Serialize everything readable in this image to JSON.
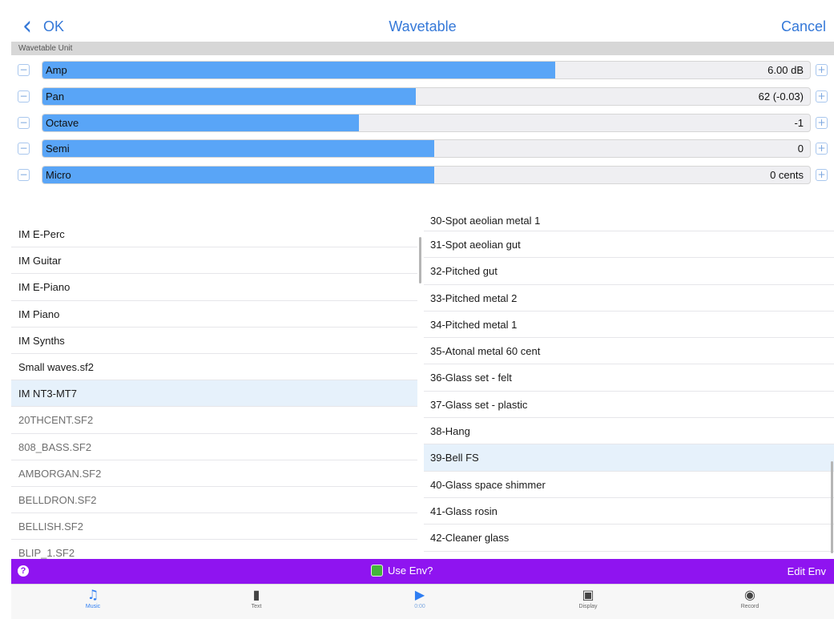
{
  "navbar": {
    "back_label": "OK",
    "title": "Wavetable",
    "cancel_label": "Cancel"
  },
  "section": {
    "header": "Wavetable Unit"
  },
  "sliders": [
    {
      "name": "Amp",
      "value": "6.00 dB",
      "level_percent": 66.8
    },
    {
      "name": "Pan",
      "value": "62 (-0.03)",
      "level_percent": 48.6
    },
    {
      "name": "Octave",
      "value": "-1",
      "level_percent": 41.2
    },
    {
      "name": "Semi",
      "value": "0",
      "level_percent": 51.0
    },
    {
      "name": "Micro",
      "value": "0 cents",
      "level_percent": 51.0
    }
  ],
  "left_list": {
    "selected_index": 6,
    "items": [
      "IM E-Perc",
      "IM Guitar",
      "IM E-Piano",
      "IM Piano",
      "IM Synths",
      "Small waves.sf2",
      "IM NT3-MT7",
      "20THCENT.SF2",
      "808_BASS.SF2",
      "AMBORGAN.SF2",
      "BELLDRON.SF2",
      "BELLISH.SF2",
      "BLIP_1.SF2"
    ]
  },
  "right_list": {
    "selected_index": 9,
    "items": [
      "30-Spot aeolian metal 1",
      "31-Spot aeolian gut",
      "32-Pitched gut",
      "33-Pitched metal 2",
      "34-Pitched metal 1",
      "35-Atonal metal 60 cent",
      "36-Glass set - felt",
      "37-Glass set - plastic",
      "38-Hang",
      "39-Bell FS",
      "40-Glass space shimmer",
      "41-Glass rosin",
      "42-Cleaner glass"
    ]
  },
  "env_bar": {
    "help_icon": "?",
    "use_env_label": "Use Env?",
    "use_env_checked": true,
    "edit_env_label": "Edit Env",
    "color": "#8f14f0"
  },
  "tabbar": {
    "tabs": [
      {
        "label": "Music",
        "icon": "music-note-icon",
        "active": true
      },
      {
        "label": "Text",
        "icon": "document-icon",
        "active": false
      },
      {
        "label": "0:00",
        "icon": "play-icon",
        "active": false
      },
      {
        "label": "Display",
        "icon": "image-icon",
        "active": false
      },
      {
        "label": "Record",
        "icon": "record-icon",
        "active": false
      }
    ]
  },
  "colors": {
    "accent": "#3478d8",
    "slider_fill": "#59a5f7",
    "selected_row": "#e6f1fb"
  }
}
